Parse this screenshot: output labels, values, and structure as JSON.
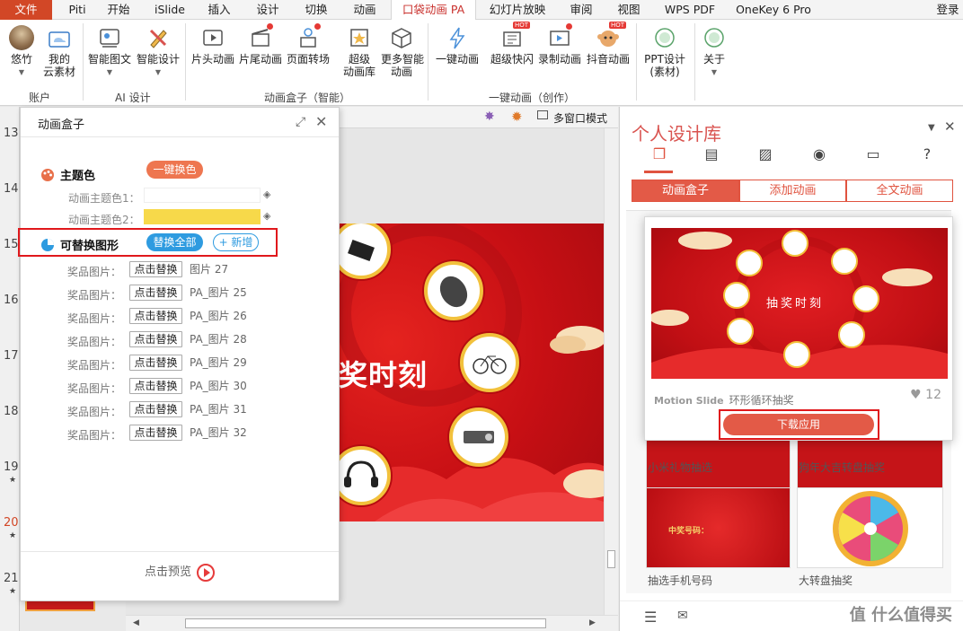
{
  "menu": {
    "tabs": [
      "文件",
      "Piti",
      "开始",
      "iSlide",
      "插入",
      "设计",
      "切换",
      "动画",
      "口袋动画 PA",
      "幻灯片放映",
      "审阅",
      "视图",
      "WPS PDF",
      "OneKey 6 Pro"
    ],
    "login": "登录"
  },
  "ribbon": {
    "account": {
      "user": "悠竹",
      "cloud_l1": "我的",
      "cloud_l2": "云素材",
      "group": "账户"
    },
    "ai": {
      "smart_pic": "智能图文",
      "smart_design": "智能设计",
      "group": "AI 设计"
    },
    "box": {
      "head_anim": "片头动画",
      "tail_anim": "片尾动画",
      "page_trans": "页面转场",
      "super_l1": "超级",
      "super_l2": "动画库",
      "more_l1": "更多智能",
      "more_l2": "动画",
      "group": "动画盒子（智能）"
    },
    "onekey": {
      "onekey_anim": "一键动画",
      "super_fast": "超级快闪",
      "record_anim": "录制动画",
      "douyin_anim": "抖音动画",
      "group": "一键动画（创作）"
    },
    "ppt": {
      "l1": "PPT设计",
      "l2": "(素材)"
    },
    "about": "关于",
    "hot": "HOT"
  },
  "slides": {
    "numbers": [
      "13",
      "14",
      "15",
      "16",
      "17",
      "18",
      "19",
      "20",
      "21"
    ],
    "current": "20",
    "star": "★"
  },
  "editor": {
    "multi_window": "多窗口模式",
    "slide_title": "奖时刻"
  },
  "panel": {
    "title": "动画盒子",
    "theme_color": "主题色",
    "one_click_color": "一键换色",
    "theme_color_1": "动画主题色1：",
    "theme_color_2": "动画主题色2：",
    "color_1": "#ffffff",
    "color_2": "#f7d94a",
    "replaceable": "可替换图形",
    "replace_all": "替换全部",
    "add_new": "+ 新增",
    "rows": [
      {
        "label": "奖品图片：",
        "button": "点击替换",
        "name": "图片 27"
      },
      {
        "label": "奖品图片：",
        "button": "点击替换",
        "name": "PA_图片 25"
      },
      {
        "label": "奖品图片：",
        "button": "点击替换",
        "name": "PA_图片 26"
      },
      {
        "label": "奖品图片：",
        "button": "点击替换",
        "name": "PA_图片 28"
      },
      {
        "label": "奖品图片：",
        "button": "点击替换",
        "name": "PA_图片 29"
      },
      {
        "label": "奖品图片：",
        "button": "点击替换",
        "name": "PA_图片 30"
      },
      {
        "label": "奖品图片：",
        "button": "点击替换",
        "name": "PA_图片 31"
      },
      {
        "label": "奖品图片：",
        "button": "点击替换",
        "name": "PA_图片 32"
      }
    ],
    "preview": "点击预览"
  },
  "library": {
    "title": "个人设计库",
    "tabs": [
      "动画盒子",
      "添加动画",
      "全文动画"
    ],
    "popup": {
      "image_text": "抽奖时刻",
      "brand": "Motion Slide",
      "name": "环形循环抽奖",
      "likes": "12",
      "download": "下载应用"
    },
    "cards": [
      {
        "label": "小米礼物抽选"
      },
      {
        "label": "狗年大吉转盘抽奖"
      },
      {
        "label": "抽选手机号码",
        "image_text": "中奖号码："
      },
      {
        "label": "大转盘抽奖"
      }
    ]
  },
  "watermark": "值 什么值得买",
  "accent": "#e35a47"
}
